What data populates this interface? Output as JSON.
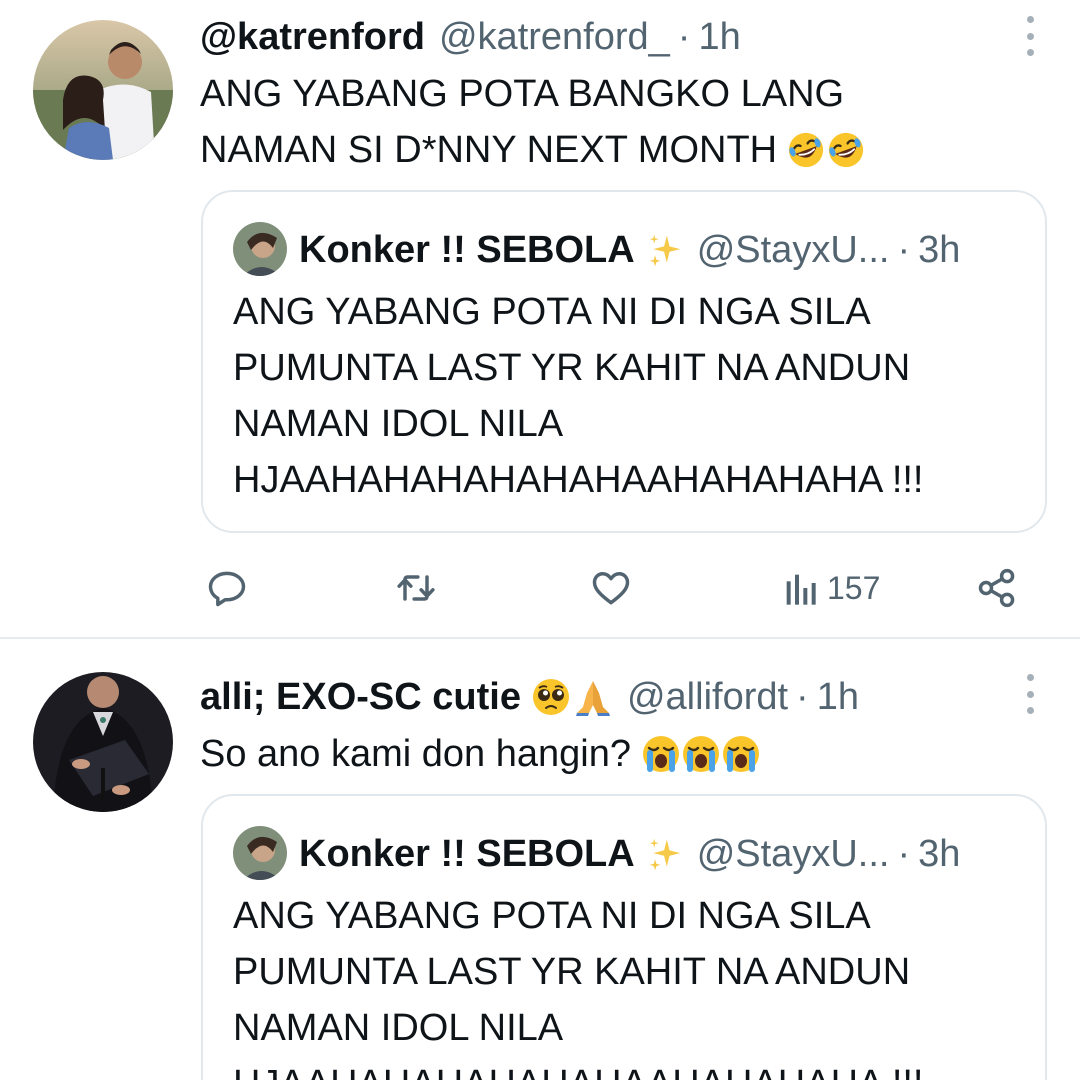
{
  "tweets": [
    {
      "author": {
        "display_name": "@katrenford",
        "handle": "@katrenford_",
        "time": "1h",
        "separator": "·"
      },
      "text_lines": [
        "ANG YABANG POTA BANGKO LANG",
        "NAMAN SI D*NNY NEXT MONTH"
      ],
      "text_emojis": [
        "rolling-on-floor-laughing",
        "rolling-on-floor-laughing"
      ],
      "quote": {
        "display_name": "Konker !! SEBOLA",
        "name_emoji": "sparkles",
        "handle": "@StayxU...",
        "separator": "·",
        "time": "3h",
        "text_lines": [
          "ANG YABANG POTA NI DI NGA SILA",
          "PUMUNTA LAST YR KAHIT NA ANDUN",
          "NAMAN IDOL NILA",
          "HJAAHAHAHAHAHAHAAHAHAHAHA !!!"
        ]
      },
      "actions": {
        "views": "157"
      }
    },
    {
      "author": {
        "display_name": "alli; EXO-SC cutie",
        "name_emojis": [
          "pleading-face",
          "folded-hands"
        ],
        "handle": "@allifordt",
        "time": "1h",
        "separator": "·"
      },
      "text_lines": [
        "So ano kami don hangin?"
      ],
      "text_emojis": [
        "loudly-crying-face",
        "loudly-crying-face",
        "loudly-crying-face"
      ],
      "quote": {
        "display_name": "Konker !! SEBOLA",
        "name_emoji": "sparkles",
        "handle": "@StayxU...",
        "separator": "·",
        "time": "3h",
        "text_lines": [
          "ANG YABANG POTA NI DI NGA SILA",
          "PUMUNTA LAST YR KAHIT NA ANDUN",
          "NAMAN IDOL NILA",
          "HJAAHAHAHAHAHAHAAHAHAHAHA !!!"
        ]
      }
    }
  ],
  "colors": {
    "text": "#0f1419",
    "secondary": "#536471",
    "border": "#e1e8ed",
    "emoji_yellow": "#f9c52b",
    "tear_blue": "#4aa3e8"
  }
}
